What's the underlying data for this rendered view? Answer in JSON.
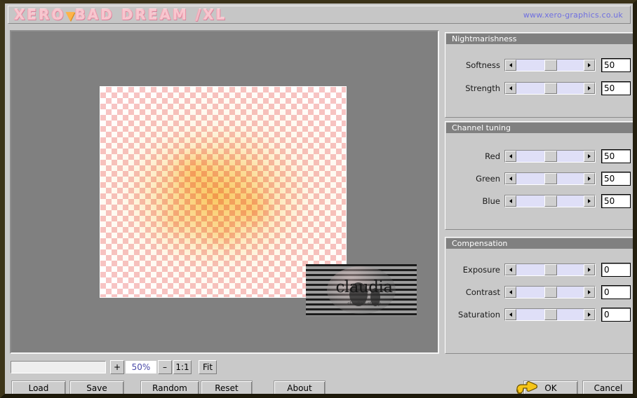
{
  "window": {
    "logo_part1": "XERO",
    "logo_sep": "▼",
    "logo_part2": "BAD DREAM",
    "logo_slash": "/",
    "logo_part3": "XL",
    "url": "www.xero-graphics.co.uk"
  },
  "preview": {
    "watermark_text": "claudia",
    "watermark_sub": "claudia's stamp"
  },
  "groups": [
    {
      "title": "Nightmarishness",
      "controls": [
        {
          "label": "Softness",
          "value": "50",
          "thumb_pct": 50
        },
        {
          "label": "Strength",
          "value": "50",
          "thumb_pct": 50
        }
      ]
    },
    {
      "title": "Channel tuning",
      "controls": [
        {
          "label": "Red",
          "value": "50",
          "thumb_pct": 50
        },
        {
          "label": "Green",
          "value": "50",
          "thumb_pct": 50
        },
        {
          "label": "Blue",
          "value": "50",
          "thumb_pct": 50
        }
      ]
    },
    {
      "title": "Compensation",
      "controls": [
        {
          "label": "Exposure",
          "value": "0",
          "thumb_pct": 50
        },
        {
          "label": "Contrast",
          "value": "0",
          "thumb_pct": 50
        },
        {
          "label": "Saturation",
          "value": "0",
          "thumb_pct": 50
        }
      ]
    }
  ],
  "zoombar": {
    "status_value": "",
    "status_placeholder": "",
    "zoom_in": "+",
    "zoom_level": "50%",
    "zoom_out": "–",
    "one_to_one": "1:1",
    "fit": "Fit"
  },
  "buttons": {
    "load": "Load",
    "save": "Save",
    "random": "Random",
    "reset": "Reset",
    "about": "About",
    "ok": "OK",
    "cancel": "Cancel"
  },
  "colors": {
    "face": "#c9c9c9",
    "group_header": "#808080",
    "slider_track": "#dfdff7",
    "canvas": "#808080",
    "url_text": "#6f6fe0",
    "logo_pink": "#f7c7cf",
    "logo_orange": "#ffb347"
  }
}
